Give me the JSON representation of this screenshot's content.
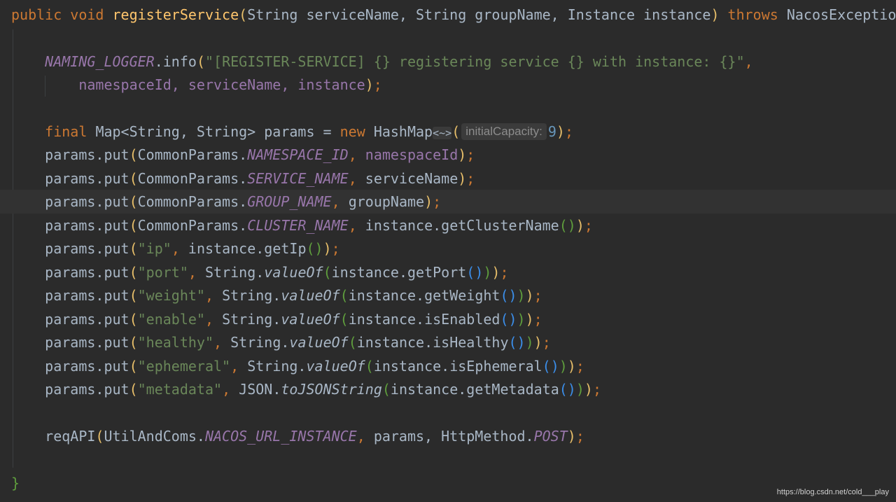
{
  "code": {
    "sig_public": "public",
    "sig_void": "void",
    "sig_method": "registerService",
    "sig_params": "String serviceName, String groupName, Instance instance",
    "sig_throws": "throws",
    "sig_exception": "NacosException",
    "logger": "NAMING_LOGGER",
    "info": ".info",
    "log_str": "\"[REGISTER-SERVICE] {} registering service {} with instance: {}\"",
    "log_args": "namespaceId, serviceName, instance",
    "final": "final",
    "map_decl": "Map<String, String> params = ",
    "new": "new",
    "hashmap": "HashMap",
    "diamond": "<~>",
    "hint_label": "initialCapacity:",
    "hint_value": "9",
    "put": "params.put",
    "cp": "CommonParams.",
    "c_namespace": "NAMESPACE_ID",
    "c_service": "SERVICE_NAME",
    "c_group": "GROUP_NAME",
    "c_cluster": "CLUSTER_NAME",
    "a_namespace": "namespaceId",
    "a_service": "serviceName",
    "a_group": "groupName",
    "a_cluster": "instance.getClusterName",
    "s_ip": "\"ip\"",
    "s_port": "\"port\"",
    "s_weight": "\"weight\"",
    "s_enable": "\"enable\"",
    "s_healthy": "\"healthy\"",
    "s_ephemeral": "\"ephemeral\"",
    "s_metadata": "\"metadata\"",
    "getip": "instance.getIp",
    "string_dot": "String.",
    "valueof": "valueOf",
    "getport": "instance.getPort",
    "getweight": "instance.getWeight",
    "isenabled": "instance.isEnabled",
    "ishealthy": "instance.isHealthy",
    "isephemeral": "instance.isEphemeral",
    "json_dot": "JSON.",
    "tojson": "toJSONString",
    "getmetadata": "instance.getMetadata",
    "reqapi": "reqAPI",
    "util": "UtilAndComs.",
    "nacos_url": "NACOS_URL_INSTANCE",
    "params_arg": "params, HttpMethod.",
    "post": "POST",
    "close_brace": "}"
  },
  "watermark": "https://blog.csdn.net/cold___play"
}
